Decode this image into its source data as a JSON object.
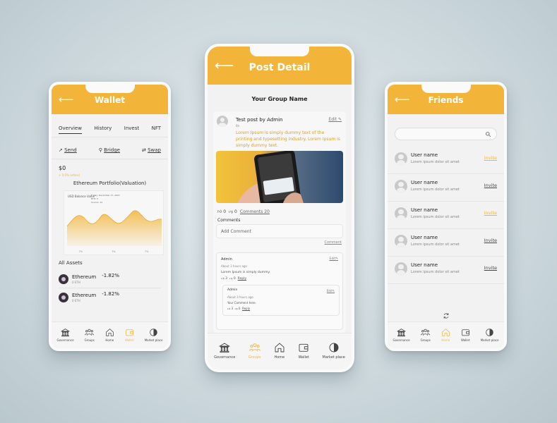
{
  "colors": {
    "accent": "#f2b53a",
    "header_text": "#ffffff",
    "background": "#cfdade"
  },
  "wallet": {
    "title": "Wallet",
    "back_icon": "arrow-left-icon",
    "tabs": [
      "Overview",
      "History",
      "Invest",
      "NFT"
    ],
    "actions": [
      {
        "label": "Send",
        "icon": "send-icon"
      },
      {
        "label": "Bridge",
        "icon": "bridge-icon"
      },
      {
        "label": "Swap",
        "icon": "swap-icon"
      }
    ],
    "balance": "$0",
    "change": "+ 0.0% (ethos)",
    "portfolio_title": "Ethereum Portfolio(Valuation)",
    "chart_label": "USD Balance Value",
    "chart_tooltip": [
      "Friday, December 17, 2021",
      "ETH: 5",
      "Source: 14"
    ],
    "chart_ticks": [
      "7%",
      "7%",
      "7%"
    ],
    "assets_title": "All Assets",
    "assets": [
      {
        "name": "Ethereum",
        "amount": "0 ETH",
        "change": "-1.82%"
      },
      {
        "name": "Ethereum",
        "amount": "0 ETH",
        "change": "-1.82%"
      }
    ],
    "nav": [
      {
        "label": "Governance",
        "icon": "bank-icon",
        "active": false
      },
      {
        "label": "Groups",
        "icon": "groups-icon",
        "active": false
      },
      {
        "label": "Home",
        "icon": "home-icon",
        "active": false
      },
      {
        "label": "Wallet",
        "icon": "wallet-icon",
        "active": true
      },
      {
        "label": "Market place",
        "icon": "marketplace-icon",
        "active": false
      }
    ]
  },
  "post": {
    "title": "Post Detail",
    "back_icon": "arrow-left-icon",
    "group_name": "Your Group Name",
    "author": "Test post by Admin",
    "time": "6h",
    "edit_label": "Edit",
    "body": "Lorem Ipsum is simply dummy text of the printing and typesetting industry. Lorem Ipsum is simply dummy text.",
    "likes": "0",
    "dislikes": "0",
    "comments_link": "Comments 20",
    "comments_label": "Comments",
    "add_comment_placeholder": "Add Comment",
    "comment_button": "Comment",
    "comments": [
      {
        "name": "Admin",
        "time": "About 3 hours ago",
        "text": "Lorem Ipsum is simply dummy.",
        "likes": "3",
        "dislikes": "0",
        "reply": "Reply",
        "edit": "Edit",
        "replies": [
          {
            "name": "Admin",
            "time": "About 3 hours ago",
            "text": "Your Comment here.",
            "likes": "3",
            "dislikes": "0",
            "reply": "Reply",
            "edit": "Edit"
          }
        ]
      }
    ],
    "nav": [
      {
        "label": "Governance",
        "icon": "bank-icon",
        "active": false
      },
      {
        "label": "Groups",
        "icon": "groups-icon",
        "active": true
      },
      {
        "label": "Home",
        "icon": "home-icon",
        "active": false
      },
      {
        "label": "Wallet",
        "icon": "wallet-icon",
        "active": false
      },
      {
        "label": "Market place",
        "icon": "marketplace-icon",
        "active": false
      }
    ]
  },
  "friends": {
    "title": "Friends",
    "back_icon": "arrow-left-icon",
    "search_icon": "search-icon",
    "rows": [
      {
        "name": "User name",
        "subtitle": "Lorem ipsum dolor sit amet",
        "action": "Invite",
        "highlight": true
      },
      {
        "name": "User name",
        "subtitle": "Lorem ipsum dolor sit amet",
        "action": "Invite",
        "highlight": false
      },
      {
        "name": "User name",
        "subtitle": "Lorem ipsum dolor sit amet",
        "action": "Invite",
        "highlight": true
      },
      {
        "name": "User name",
        "subtitle": "Lorem ipsum dolor sit amet",
        "action": "Invite",
        "highlight": false
      },
      {
        "name": "User name",
        "subtitle": "Lorem ipsum dolor sit amet",
        "action": "Invite",
        "highlight": false
      }
    ],
    "refresh_icon": "refresh-icon",
    "nav": [
      {
        "label": "Governance",
        "icon": "bank-icon",
        "active": false
      },
      {
        "label": "Groups",
        "icon": "groups-icon",
        "active": false
      },
      {
        "label": "Home",
        "icon": "home-icon",
        "active": true
      },
      {
        "label": "Wallet",
        "icon": "wallet-icon",
        "active": false
      },
      {
        "label": "Market place",
        "icon": "marketplace-icon",
        "active": false
      }
    ]
  }
}
